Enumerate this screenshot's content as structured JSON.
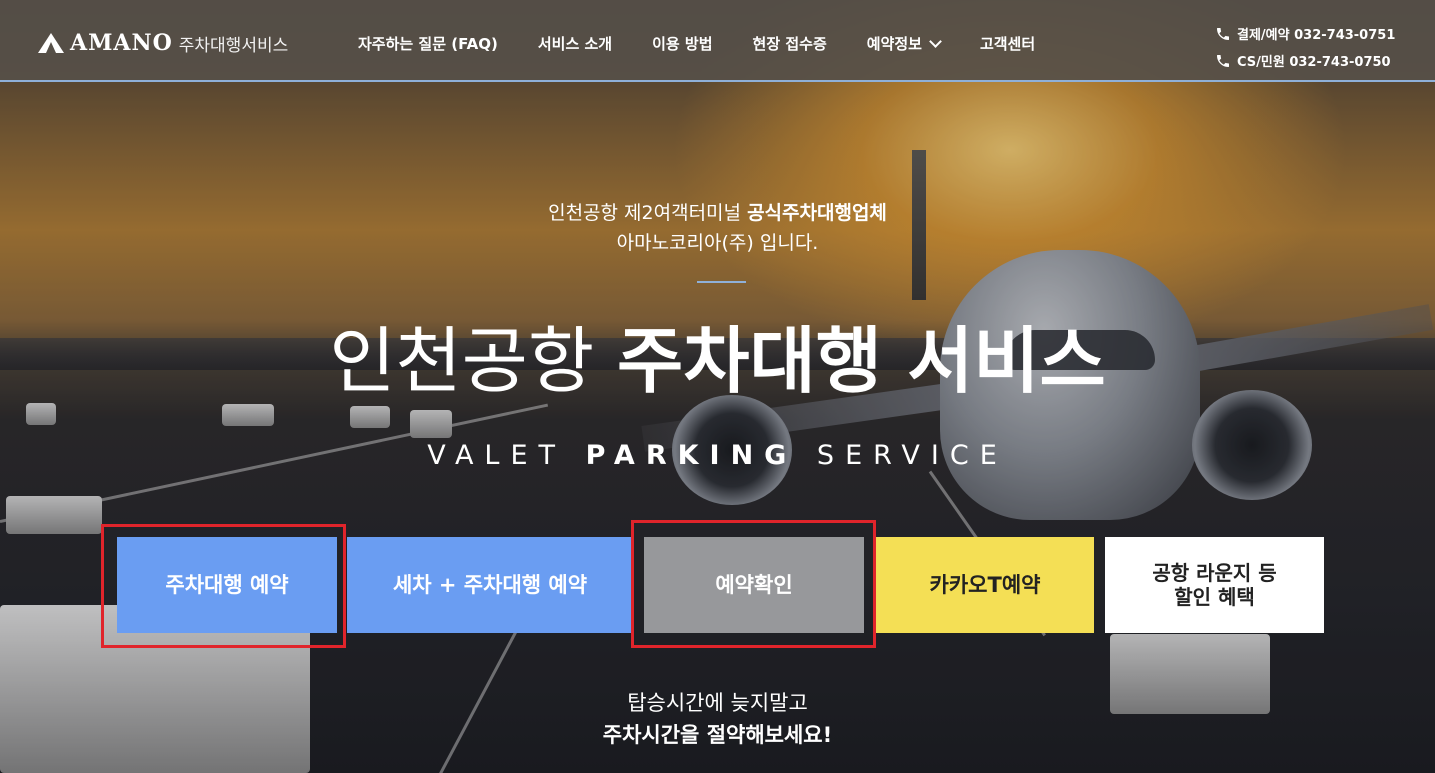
{
  "header": {
    "logo": {
      "brand": "AMANO",
      "sub": "주차대행서비스"
    },
    "nav": [
      {
        "label": "자주하는 질문 (FAQ)"
      },
      {
        "label": "서비스 소개"
      },
      {
        "label": "이용 방법"
      },
      {
        "label": "현장 접수증"
      },
      {
        "label": "예약정보",
        "has_dropdown": true
      },
      {
        "label": "고객센터"
      }
    ],
    "contacts": [
      {
        "icon": "phone-icon",
        "label": "결제/예약 032-743-0751"
      },
      {
        "icon": "phone-icon",
        "label": "CS/민원 032-743-0750"
      }
    ]
  },
  "hero": {
    "intro_line1_prefix": "인천공항 제2여객터미널 ",
    "intro_line1_bold": "공식주차대행업체",
    "intro_line2": "아마노코리아(주) 입니다.",
    "headline_light": "인천공항 ",
    "headline_bold": "주차대행 서비스",
    "tagline_pre": "VALET ",
    "tagline_bold": "PARKING",
    "tagline_post": " SERVICE"
  },
  "buttons": {
    "reserve": "주차대행 예약",
    "wash": "세차 + 주차대행 예약",
    "confirm": "예약확인",
    "kakao": "카카오T예약",
    "lounge_line1": "공항 라운지 등",
    "lounge_line2": "할인 혜택"
  },
  "bottom": {
    "line1": "탑승시간에 늦지말고",
    "line2": "주차시간을 절약해보세요!"
  },
  "colors": {
    "header_bg": "#565048",
    "accent_blue": "#6a9df2",
    "confirm_gray": "#97989b",
    "kakao_yellow": "#f4df55",
    "highlight_red": "#e0242b"
  }
}
